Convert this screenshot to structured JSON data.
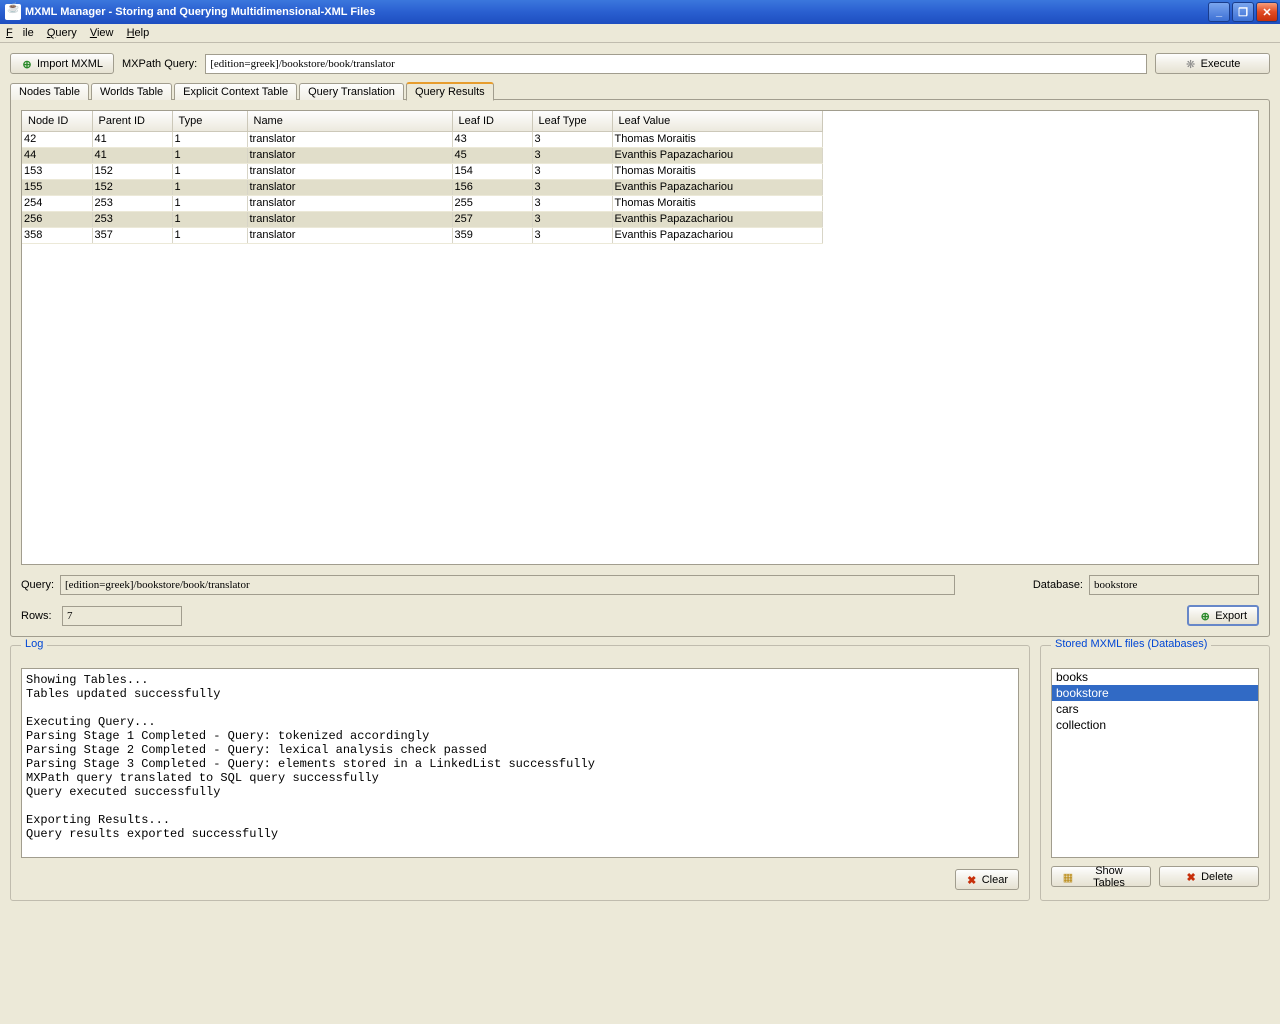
{
  "window": {
    "title": "MXML Manager - Storing and Querying Multidimensional-XML Files"
  },
  "menus": {
    "file": "File",
    "query": "Query",
    "view": "View",
    "help": "Help"
  },
  "toolbar": {
    "import_btn": "Import MXML",
    "mxpath_label": "MXPath Query:",
    "query_value": "[edition=greek]/bookstore/book/translator",
    "execute_btn": "Execute"
  },
  "tabs": {
    "nodes": "Nodes Table",
    "worlds": "Worlds Table",
    "explicit": "Explicit Context Table",
    "translation": "Query Translation",
    "results": "Query Results"
  },
  "results_table": {
    "columns": [
      "Node ID",
      "Parent ID",
      "Type",
      "Name",
      "Leaf ID",
      "Leaf Type",
      "Leaf Value"
    ],
    "rows": [
      [
        "42",
        "41",
        "1",
        "translator",
        "43",
        "3",
        "Thomas Moraitis"
      ],
      [
        "44",
        "41",
        "1",
        "translator",
        "45",
        "3",
        "Evanthis Papazachariou"
      ],
      [
        "153",
        "152",
        "1",
        "translator",
        "154",
        "3",
        "Thomas Moraitis"
      ],
      [
        "155",
        "152",
        "1",
        "translator",
        "156",
        "3",
        "Evanthis Papazachariou"
      ],
      [
        "254",
        "253",
        "1",
        "translator",
        "255",
        "3",
        "Thomas Moraitis"
      ],
      [
        "256",
        "253",
        "1",
        "translator",
        "257",
        "3",
        "Evanthis Papazachariou"
      ],
      [
        "358",
        "357",
        "1",
        "translator",
        "359",
        "3",
        "Evanthis Papazachariou"
      ]
    ]
  },
  "query_info": {
    "query_label": "Query:",
    "query_value": "[edition=greek]/bookstore/book/translator",
    "database_label": "Database:",
    "database_value": "bookstore",
    "rows_label": "Rows:",
    "rows_value": "7",
    "export_btn": "Export"
  },
  "log": {
    "legend": "Log",
    "text": "Showing Tables...\nTables updated successfully\n\nExecuting Query...\nParsing Stage 1 Completed - Query: tokenized accordingly\nParsing Stage 2 Completed - Query: lexical analysis check passed\nParsing Stage 3 Completed - Query: elements stored in a LinkedList successfully\nMXPath query translated to SQL query successfully\nQuery executed successfully\n\nExporting Results...\nQuery results exported successfully",
    "clear_btn": "Clear"
  },
  "databases": {
    "legend": "Stored MXML files (Databases)",
    "items": [
      "books",
      "bookstore",
      "cars",
      "collection"
    ],
    "selected": "bookstore",
    "show_tables_btn": "Show Tables",
    "delete_btn": "Delete"
  }
}
